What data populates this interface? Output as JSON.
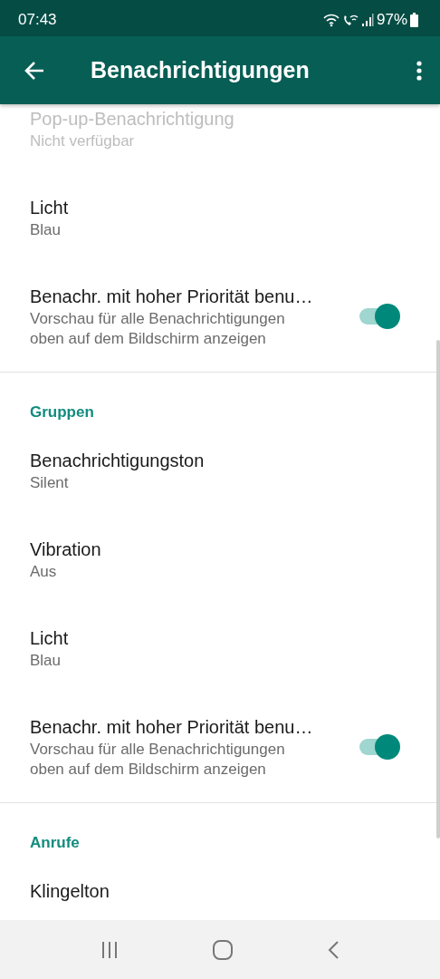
{
  "status_bar": {
    "time": "07:43",
    "battery": "97%"
  },
  "app_bar": {
    "title": "Benachrichtigungen"
  },
  "sections": [
    {
      "items": [
        {
          "kind": "plain",
          "title": "Pop-up-Benachrichtigung",
          "subtitle": "Nicht verfügbar",
          "disabled": true
        },
        {
          "kind": "plain",
          "title": "Licht",
          "subtitle": "Blau",
          "disabled": false
        },
        {
          "kind": "toggle",
          "title": "Benachr. mit hoher Priorität benu…",
          "subtitle": "Vorschau für alle Benachrichtigungen oben auf dem Bildschirm anzeigen",
          "disabled": false,
          "on": true
        }
      ]
    },
    {
      "header": "Gruppen",
      "items": [
        {
          "kind": "plain",
          "title": "Benachrichtigungston",
          "subtitle": "Silent",
          "disabled": false
        },
        {
          "kind": "plain",
          "title": "Vibration",
          "subtitle": "Aus",
          "disabled": false
        },
        {
          "kind": "plain",
          "title": "Licht",
          "subtitle": "Blau",
          "disabled": false
        },
        {
          "kind": "toggle",
          "title": "Benachr. mit hoher Priorität benu…",
          "subtitle": "Vorschau für alle Benachrichtigungen oben auf dem Bildschirm anzeigen",
          "disabled": false,
          "on": true
        }
      ]
    },
    {
      "header": "Anrufe",
      "items": [
        {
          "kind": "plain",
          "title": "Klingelton",
          "disabled": false
        }
      ]
    }
  ]
}
